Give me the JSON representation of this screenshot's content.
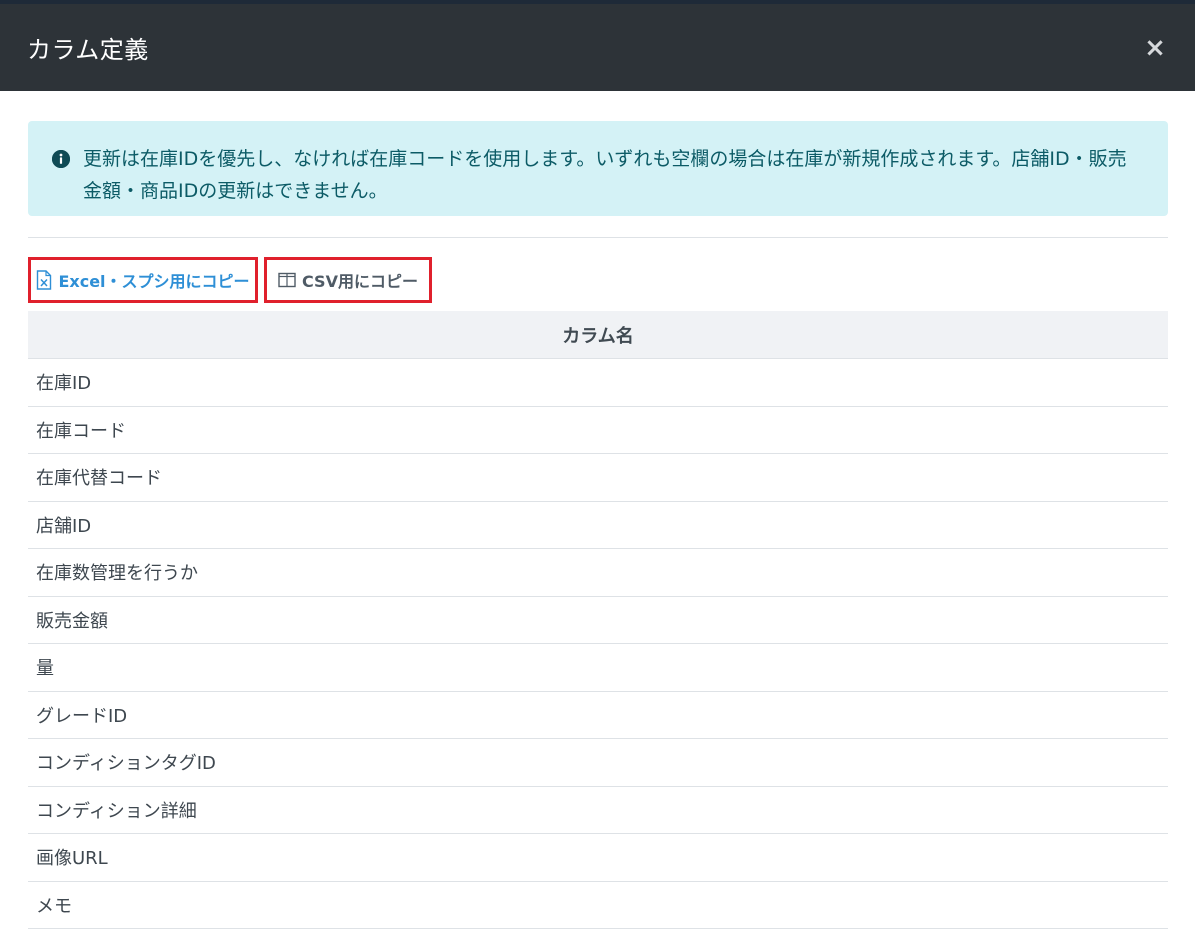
{
  "modal": {
    "title": "カラム定義",
    "close_label": "×"
  },
  "alert": {
    "icon": "info-circle-icon",
    "text": "更新は在庫IDを優先し、なければ在庫コードを使用します。いずれも空欄の場合は在庫が新規作成されます。店舗ID・販売金額・商品IDの更新はできません。"
  },
  "toolbar": {
    "excel_label": "Excel・スプシ用にコピー",
    "csv_label": "CSV用にコピー",
    "highlight_color": "#e0202c"
  },
  "table": {
    "header": "カラム名",
    "rows": [
      "在庫ID",
      "在庫コード",
      "在庫代替コード",
      "店舗ID",
      "在庫数管理を行うか",
      "販売金額",
      "量",
      "グレードID",
      "コンディションタグID",
      "コンディション詳細",
      "画像URL",
      "メモ"
    ]
  },
  "colors": {
    "header_bg": "#2d3338",
    "alert_bg": "#d4f2f6",
    "alert_text": "#0c5b66",
    "link_blue": "#2e8fd6"
  }
}
